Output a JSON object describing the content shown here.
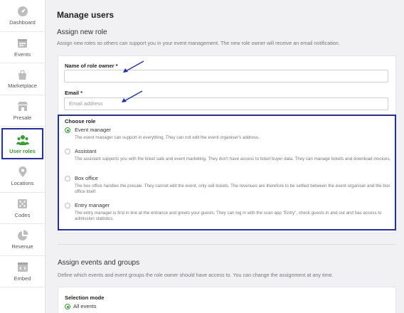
{
  "sidebar": {
    "items": [
      {
        "label": "Dashboard",
        "icon": "dashboard-icon"
      },
      {
        "label": "Events",
        "icon": "calendar-icon"
      },
      {
        "label": "Marketplace",
        "icon": "shopping-bag-icon"
      },
      {
        "label": "Presale",
        "icon": "storefront-icon"
      },
      {
        "label": "User roles",
        "icon": "users-icon",
        "active": true
      },
      {
        "label": "Locations",
        "icon": "location-pin-icon"
      },
      {
        "label": "Codes",
        "icon": "dice-icon"
      },
      {
        "label": "Revenue",
        "icon": "pie-chart-icon"
      },
      {
        "label": "Embed",
        "icon": "embed-icon"
      }
    ]
  },
  "page": {
    "title": "Manage users"
  },
  "assign_role": {
    "title": "Assign new role",
    "description": "Assign new roles so others can support you in your event management. The new role owner will receive an email notification.",
    "name_label": "Name of role owner *",
    "name_value": "",
    "email_label": "Email *",
    "email_placeholder": "Email address"
  },
  "roles": {
    "heading": "Choose role",
    "options": [
      {
        "name": "Event manager",
        "selected": true,
        "desc": "The event manager can support in everything. They can not edit the event organiser's address."
      },
      {
        "name": "Assistant",
        "selected": false,
        "desc": "The assistant supports you with the ticket sale and event marketing. They don't have access to ticket buyer data. They can manage tickets and download invoices."
      },
      {
        "name": "Box office",
        "selected": false,
        "desc": "The box office handles the presale. They cannot edit the event, only sell tickets. The revenues are therefore to be settled between the event organiser and the box office itself."
      },
      {
        "name": "Entry manager",
        "selected": false,
        "desc": "The entry manager is first in line at the entrance and greets your guests. They can log in with the scan app \"Entry\", check guests in and out and has access to admission statistics."
      }
    ]
  },
  "assign_events": {
    "title": "Assign events and groups",
    "description": "Define which events and event groups the role owner should have access to. You can change the assignment at any time.",
    "selection_label": "Selection mode",
    "selection_value": "All events"
  },
  "colors": {
    "accent": "#35a02e",
    "highlight": "#1f2fb5"
  }
}
